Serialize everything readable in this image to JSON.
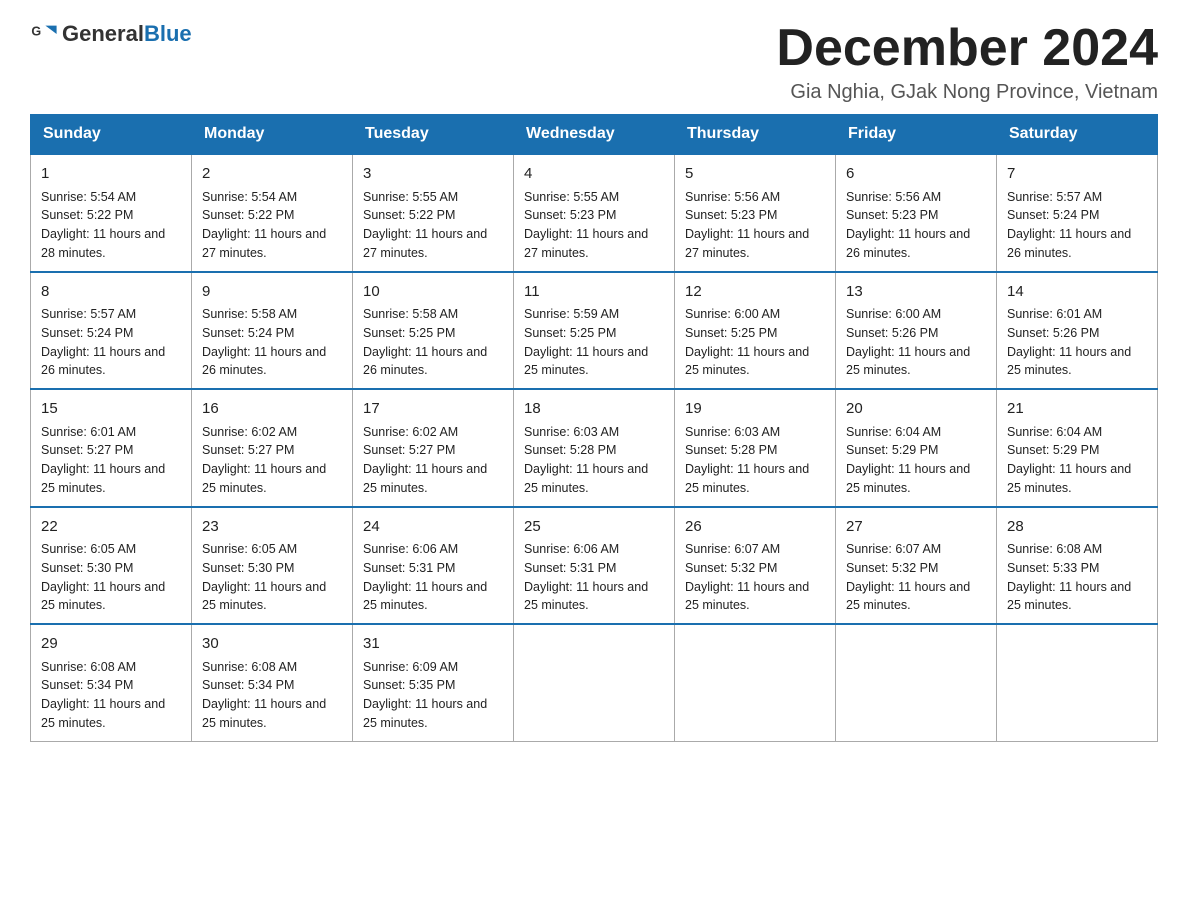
{
  "header": {
    "logo_general": "General",
    "logo_blue": "Blue",
    "month_title": "December 2024",
    "location": "Gia Nghia, GJak Nong Province, Vietnam"
  },
  "days_of_week": [
    "Sunday",
    "Monday",
    "Tuesday",
    "Wednesday",
    "Thursday",
    "Friday",
    "Saturday"
  ],
  "weeks": [
    [
      {
        "day": "1",
        "sunrise": "Sunrise: 5:54 AM",
        "sunset": "Sunset: 5:22 PM",
        "daylight": "Daylight: 11 hours and 28 minutes."
      },
      {
        "day": "2",
        "sunrise": "Sunrise: 5:54 AM",
        "sunset": "Sunset: 5:22 PM",
        "daylight": "Daylight: 11 hours and 27 minutes."
      },
      {
        "day": "3",
        "sunrise": "Sunrise: 5:55 AM",
        "sunset": "Sunset: 5:22 PM",
        "daylight": "Daylight: 11 hours and 27 minutes."
      },
      {
        "day": "4",
        "sunrise": "Sunrise: 5:55 AM",
        "sunset": "Sunset: 5:23 PM",
        "daylight": "Daylight: 11 hours and 27 minutes."
      },
      {
        "day": "5",
        "sunrise": "Sunrise: 5:56 AM",
        "sunset": "Sunset: 5:23 PM",
        "daylight": "Daylight: 11 hours and 27 minutes."
      },
      {
        "day": "6",
        "sunrise": "Sunrise: 5:56 AM",
        "sunset": "Sunset: 5:23 PM",
        "daylight": "Daylight: 11 hours and 26 minutes."
      },
      {
        "day": "7",
        "sunrise": "Sunrise: 5:57 AM",
        "sunset": "Sunset: 5:24 PM",
        "daylight": "Daylight: 11 hours and 26 minutes."
      }
    ],
    [
      {
        "day": "8",
        "sunrise": "Sunrise: 5:57 AM",
        "sunset": "Sunset: 5:24 PM",
        "daylight": "Daylight: 11 hours and 26 minutes."
      },
      {
        "day": "9",
        "sunrise": "Sunrise: 5:58 AM",
        "sunset": "Sunset: 5:24 PM",
        "daylight": "Daylight: 11 hours and 26 minutes."
      },
      {
        "day": "10",
        "sunrise": "Sunrise: 5:58 AM",
        "sunset": "Sunset: 5:25 PM",
        "daylight": "Daylight: 11 hours and 26 minutes."
      },
      {
        "day": "11",
        "sunrise": "Sunrise: 5:59 AM",
        "sunset": "Sunset: 5:25 PM",
        "daylight": "Daylight: 11 hours and 25 minutes."
      },
      {
        "day": "12",
        "sunrise": "Sunrise: 6:00 AM",
        "sunset": "Sunset: 5:25 PM",
        "daylight": "Daylight: 11 hours and 25 minutes."
      },
      {
        "day": "13",
        "sunrise": "Sunrise: 6:00 AM",
        "sunset": "Sunset: 5:26 PM",
        "daylight": "Daylight: 11 hours and 25 minutes."
      },
      {
        "day": "14",
        "sunrise": "Sunrise: 6:01 AM",
        "sunset": "Sunset: 5:26 PM",
        "daylight": "Daylight: 11 hours and 25 minutes."
      }
    ],
    [
      {
        "day": "15",
        "sunrise": "Sunrise: 6:01 AM",
        "sunset": "Sunset: 5:27 PM",
        "daylight": "Daylight: 11 hours and 25 minutes."
      },
      {
        "day": "16",
        "sunrise": "Sunrise: 6:02 AM",
        "sunset": "Sunset: 5:27 PM",
        "daylight": "Daylight: 11 hours and 25 minutes."
      },
      {
        "day": "17",
        "sunrise": "Sunrise: 6:02 AM",
        "sunset": "Sunset: 5:27 PM",
        "daylight": "Daylight: 11 hours and 25 minutes."
      },
      {
        "day": "18",
        "sunrise": "Sunrise: 6:03 AM",
        "sunset": "Sunset: 5:28 PM",
        "daylight": "Daylight: 11 hours and 25 minutes."
      },
      {
        "day": "19",
        "sunrise": "Sunrise: 6:03 AM",
        "sunset": "Sunset: 5:28 PM",
        "daylight": "Daylight: 11 hours and 25 minutes."
      },
      {
        "day": "20",
        "sunrise": "Sunrise: 6:04 AM",
        "sunset": "Sunset: 5:29 PM",
        "daylight": "Daylight: 11 hours and 25 minutes."
      },
      {
        "day": "21",
        "sunrise": "Sunrise: 6:04 AM",
        "sunset": "Sunset: 5:29 PM",
        "daylight": "Daylight: 11 hours and 25 minutes."
      }
    ],
    [
      {
        "day": "22",
        "sunrise": "Sunrise: 6:05 AM",
        "sunset": "Sunset: 5:30 PM",
        "daylight": "Daylight: 11 hours and 25 minutes."
      },
      {
        "day": "23",
        "sunrise": "Sunrise: 6:05 AM",
        "sunset": "Sunset: 5:30 PM",
        "daylight": "Daylight: 11 hours and 25 minutes."
      },
      {
        "day": "24",
        "sunrise": "Sunrise: 6:06 AM",
        "sunset": "Sunset: 5:31 PM",
        "daylight": "Daylight: 11 hours and 25 minutes."
      },
      {
        "day": "25",
        "sunrise": "Sunrise: 6:06 AM",
        "sunset": "Sunset: 5:31 PM",
        "daylight": "Daylight: 11 hours and 25 minutes."
      },
      {
        "day": "26",
        "sunrise": "Sunrise: 6:07 AM",
        "sunset": "Sunset: 5:32 PM",
        "daylight": "Daylight: 11 hours and 25 minutes."
      },
      {
        "day": "27",
        "sunrise": "Sunrise: 6:07 AM",
        "sunset": "Sunset: 5:32 PM",
        "daylight": "Daylight: 11 hours and 25 minutes."
      },
      {
        "day": "28",
        "sunrise": "Sunrise: 6:08 AM",
        "sunset": "Sunset: 5:33 PM",
        "daylight": "Daylight: 11 hours and 25 minutes."
      }
    ],
    [
      {
        "day": "29",
        "sunrise": "Sunrise: 6:08 AM",
        "sunset": "Sunset: 5:34 PM",
        "daylight": "Daylight: 11 hours and 25 minutes."
      },
      {
        "day": "30",
        "sunrise": "Sunrise: 6:08 AM",
        "sunset": "Sunset: 5:34 PM",
        "daylight": "Daylight: 11 hours and 25 minutes."
      },
      {
        "day": "31",
        "sunrise": "Sunrise: 6:09 AM",
        "sunset": "Sunset: 5:35 PM",
        "daylight": "Daylight: 11 hours and 25 minutes."
      },
      null,
      null,
      null,
      null
    ]
  ]
}
